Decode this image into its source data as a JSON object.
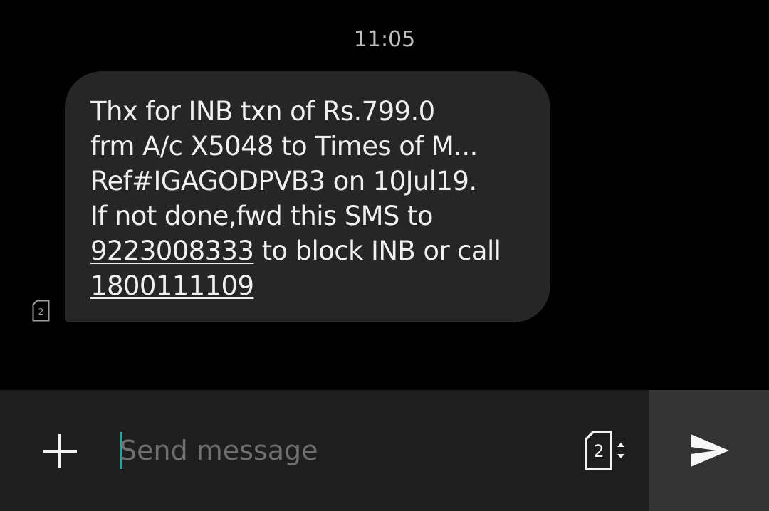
{
  "conversation": {
    "timestamp": "11:05",
    "message": {
      "line1": "Thx for INB txn of Rs.799.0",
      "line2": "frm A/c X5048 to Times of M...",
      "line3": "Ref#IGAGODPVB3 on 10Jul19.",
      "line4": "If not done,fwd this SMS to",
      "phone_link": "9223008333",
      "line5_rest": " to block INB or call",
      "tollfree_link": "1800111109"
    },
    "sim_badge": "2"
  },
  "composer": {
    "placeholder": "Send message",
    "sim_selector": "2",
    "attach_icon": "plus-icon",
    "send_icon": "send-icon"
  },
  "colors": {
    "background": "#000000",
    "bubble": "#262626",
    "composer": "#1e1e1e",
    "send_button": "#333333",
    "cursor_accent": "#26a69a"
  }
}
